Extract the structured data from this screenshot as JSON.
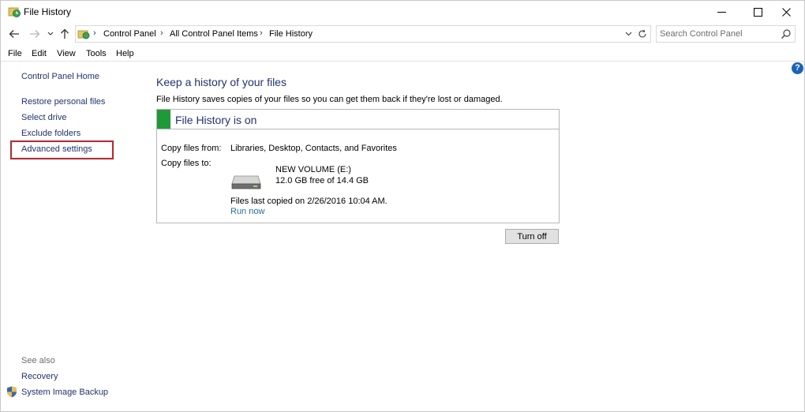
{
  "window": {
    "title": "File History"
  },
  "address": {
    "crumbs": [
      "Control Panel",
      "All Control Panel Items",
      "File History"
    ],
    "separator": "›",
    "search_placeholder": "Search Control Panel"
  },
  "menu": [
    "File",
    "Edit",
    "View",
    "Tools",
    "Help"
  ],
  "left_pane": {
    "home": "Control Panel Home",
    "links": [
      "Restore personal files",
      "Select drive",
      "Exclude folders",
      "Advanced settings"
    ],
    "see_also": "See also",
    "see_also_links": [
      "Recovery",
      "System Image Backup"
    ]
  },
  "main": {
    "heading": "Keep a history of your files",
    "description": "File History saves copies of your files so you can get them back if they're lost or damaged.",
    "status": "File History is on",
    "copy_from_label": "Copy files from:",
    "copy_from_value": "Libraries, Desktop, Contacts, and Favorites",
    "copy_to_label": "Copy files to:",
    "drive_name": "NEW VOLUME (E:)",
    "drive_space": "12.0 GB free of 14.4 GB",
    "last_copied": "Files last copied on 2/26/2016 10:04 AM.",
    "run_now": "Run now",
    "turn_off": "Turn off"
  },
  "colors": {
    "link": "#1e3287",
    "status_green": "#1f9a38",
    "highlight": "#d0202a",
    "help": "#1565c0"
  },
  "icons": {
    "app": "file-history-icon",
    "help": "?",
    "shield": "shield-icon",
    "drive": "drive-icon"
  }
}
